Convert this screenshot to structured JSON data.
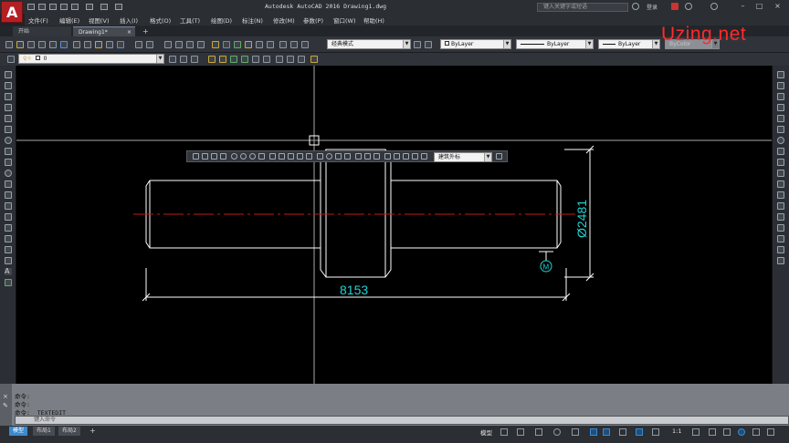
{
  "app": {
    "window_title": "Autodesk AutoCAD 2016   Drawing1.dwg",
    "logo_letter": "A",
    "search_placeholder": "键入关键字或短语",
    "user_label": "登录",
    "watermark": "Uzing.net"
  },
  "menus": [
    "文件(F)",
    "编辑(E)",
    "视图(V)",
    "插入(I)",
    "格式(O)",
    "工具(T)",
    "绘图(D)",
    "标注(N)",
    "修改(M)",
    "参数(P)",
    "窗口(W)",
    "帮助(H)"
  ],
  "file_tabs": {
    "start": "开始",
    "drawing": "Drawing1*",
    "close": "×",
    "add": "+"
  },
  "toolbar": {
    "workspace": "经典模式",
    "color": "ByLayer",
    "linetype": "ByLayer",
    "lineweight": "ByLayer",
    "plotstyle": "ByColor",
    "layer_value": "0"
  },
  "dim_toolbar": {
    "dimstyle": "建筑外标"
  },
  "drawing": {
    "dim_length": "8153",
    "dim_diameter": "Ø2481",
    "marker": "M",
    "accent_cyan": "#1fd3d3",
    "centerline_red": "#c01818"
  },
  "command": {
    "history": [
      "命令:",
      "命令:",
      "命令: _TEXTEDIT"
    ],
    "placeholder": "键入命令"
  },
  "layout_tabs": [
    "模型",
    "布局1",
    "布局2"
  ],
  "layout_add": "+",
  "status": {
    "model": "模型",
    "scale": "1:1"
  }
}
